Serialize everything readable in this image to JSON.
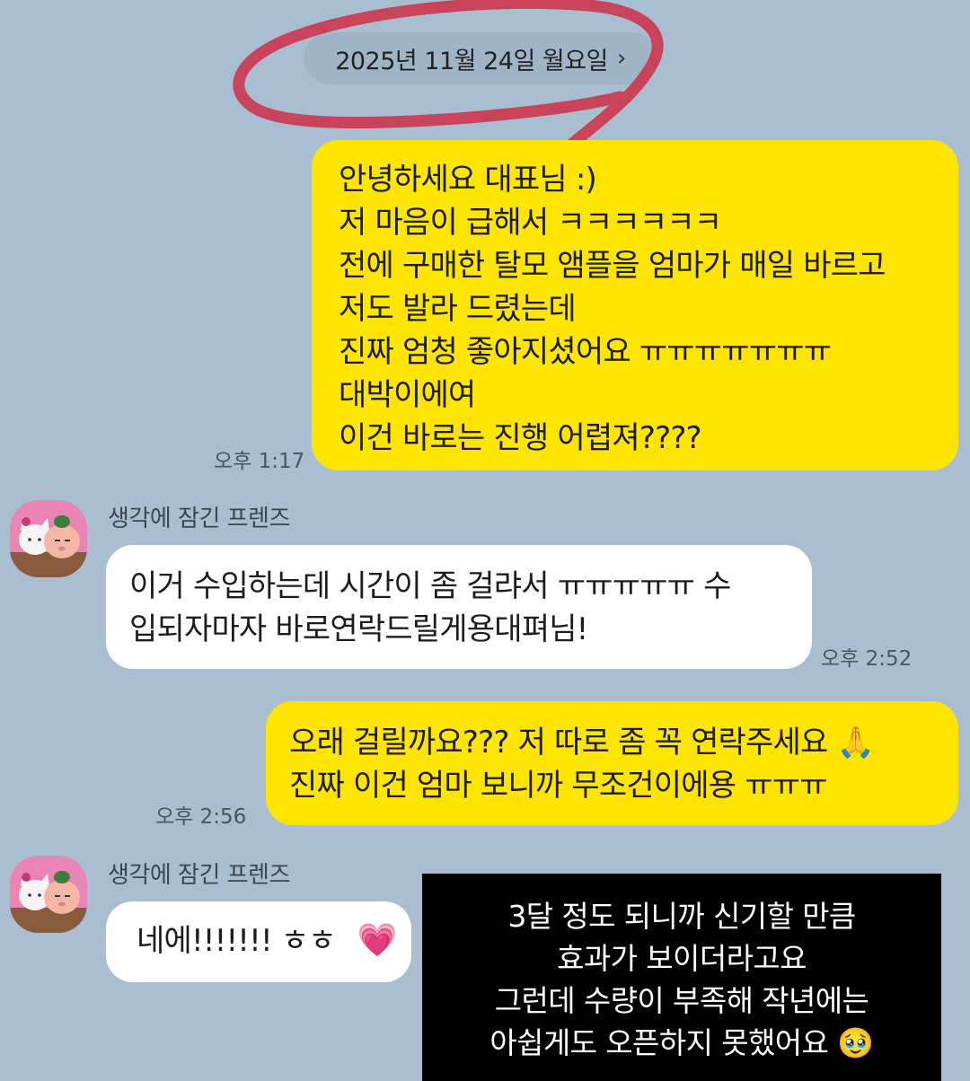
{
  "chat": {
    "date_label": "2025년 11월 24일 월요일",
    "date_chevron": "›",
    "messages": [
      {
        "from": "me",
        "time": "오후 1:17",
        "lines": [
          "안녕하세요 대표님 :)",
          "저 마음이 급해서 ㅋㅋㅋㅋㅋㅋ",
          "전에 구매한 탈모 앰플을 엄마가 매일 바르고",
          "저도 발라 드렸는데",
          "진짜 엄청 좋아지셨어요 ㅠㅠㅠㅠㅠㅠㅠ",
          "대박이에여",
          "이건 바로는 진행 어렵져????"
        ]
      },
      {
        "from": "them",
        "sender": "생각에 잠긴 프렌즈",
        "time": "오후 2:52",
        "lines": [
          "이거 수입하는데 시간이 좀 걸랴서 ㅠㅠㅠㅠㅠ 수",
          "입되자마자 바로연락드릴게용대펴님!"
        ]
      },
      {
        "from": "me",
        "time": "오후 2:56",
        "lines": [
          "오래 걸릴까요??? 저 따로 좀 꼭 연락주세요 🙏",
          "진짜 이건 엄마 보니까 무조건이에용 ㅠㅠㅠ"
        ]
      },
      {
        "from": "them",
        "sender": "생각에 잠긴 프렌즈",
        "text": "네에!!!!!!! ㅎㅎ",
        "emoji": "💗"
      }
    ]
  },
  "caption": {
    "lines": [
      "3달 정도 되니까 신기할 만큼",
      "효과가 보이더라고요",
      "그런데 수량이 부족해 작년에는",
      "아쉽게도 오픈하지 못했어요 🥹"
    ]
  },
  "colors": {
    "background": "#a9bfd1",
    "my_bubble": "#fee500",
    "their_bubble": "#ffffff",
    "annotation_circle": "#c9435a",
    "caption_box": "#000000"
  },
  "icons": {
    "avatar": "friends-character-avatar",
    "date_chevron": "chevron-right-icon"
  }
}
